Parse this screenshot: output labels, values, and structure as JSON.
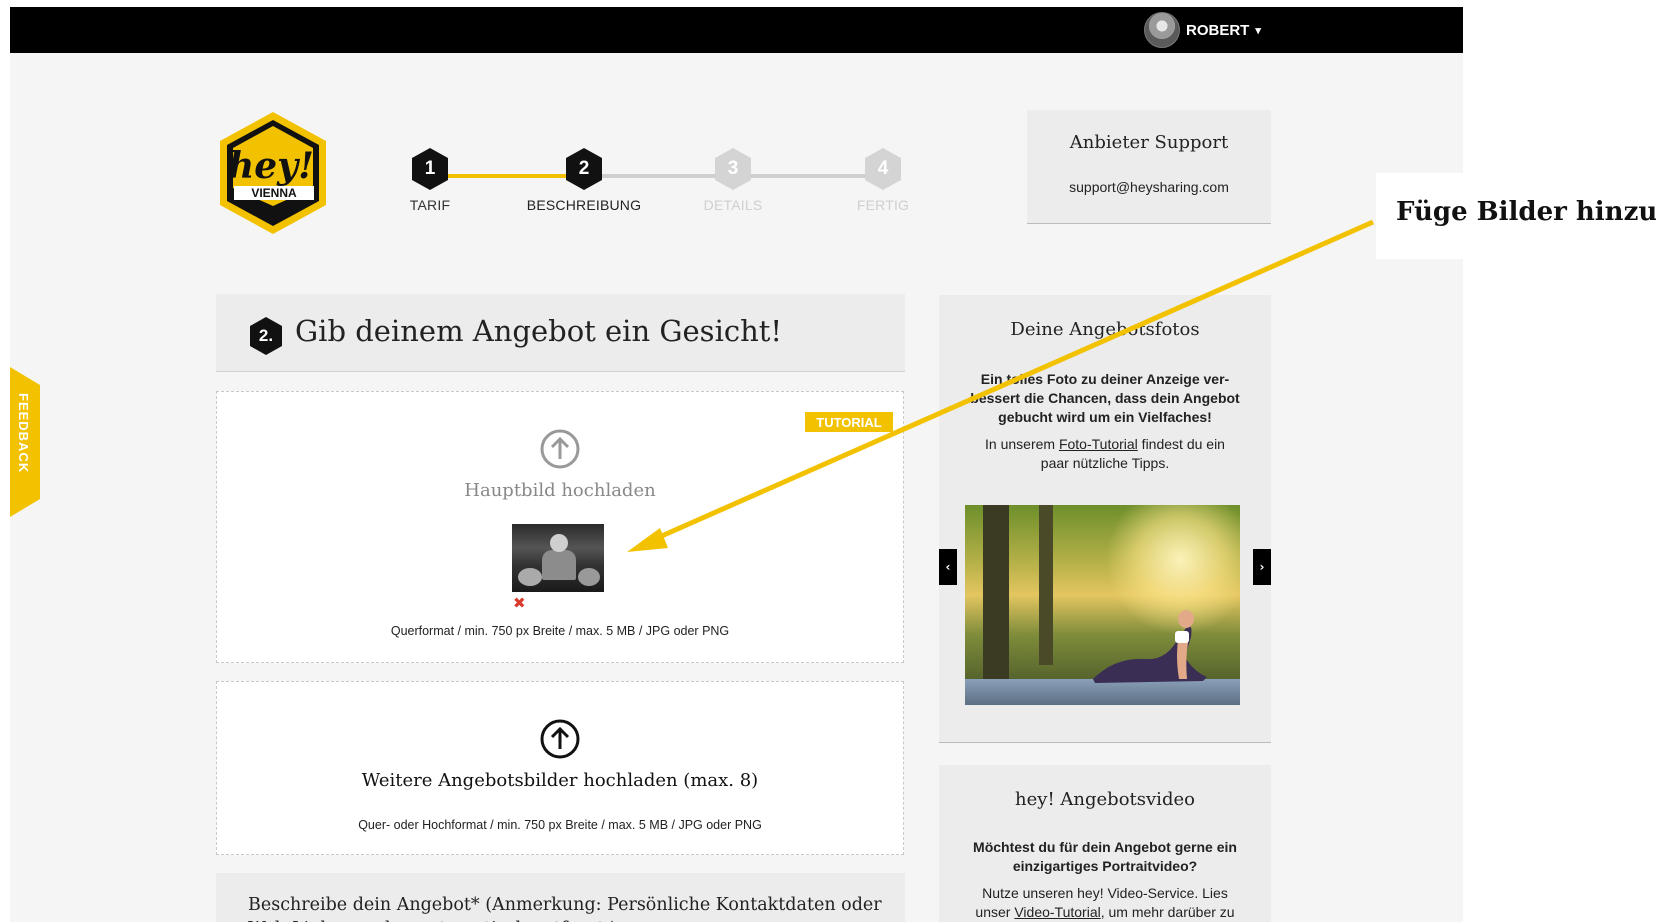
{
  "topbar": {
    "user_name": "ROBERT",
    "caret": "▾"
  },
  "logo": {
    "word": "hey!",
    "city": "VIENNA",
    "colors": {
      "yellow": "#f2c200",
      "black": "#111111"
    }
  },
  "steps": [
    {
      "number": "1",
      "label": "TARIF",
      "state": "done"
    },
    {
      "number": "2",
      "label": "BESCHREIBUNG",
      "state": "active"
    },
    {
      "number": "3",
      "label": "DETAILS",
      "state": "upcoming"
    },
    {
      "number": "4",
      "label": "FERTIG",
      "state": "upcoming"
    }
  ],
  "support": {
    "title": "Anbieter Support",
    "email": "support@heysharing.com"
  },
  "feedback": {
    "label": "FEEDBACK"
  },
  "section": {
    "number": "2.",
    "title": "Gib deinem Angebot ein Gesicht!"
  },
  "main_upload": {
    "tutorial_badge": "TUTORIAL",
    "label": "Hauptbild hochladen",
    "delete_icon": "✖",
    "hint": "Querformat / min. 750 px Breite / max. 5 MB / JPG oder PNG"
  },
  "more_upload": {
    "label": "Weitere Angebotsbilder hochladen (max. 8)",
    "hint": "Quer- oder Hochformat / min. 750 px Breite / max. 5 MB / JPG oder PNG"
  },
  "description": {
    "title": "Beschreibe dein Angebot* (Anmerkung: Persönliche Kontaktdaten oder Web-Links werden automatisch entfernt.)"
  },
  "photos_panel": {
    "title": "Deine Angebotsfotos",
    "bold_text": "Ein tolles Foto zu deiner Anzeige ver-bessert die Chancen, dass dein Angebot gebucht wird um ein Vielfaches!",
    "text_before": "In unserem ",
    "link": "Foto-Tutorial",
    "text_after": " findest du ein paar nützliche Tipps.",
    "prev": "‹",
    "next": "›"
  },
  "video_panel": {
    "title": "hey! Angebotsvideo",
    "bold_text": "Möchtest du für dein Angebot gerne ein einzigartiges Portraitvideo?",
    "text_before": "Nutze unseren hey! Video-Service. Lies unser ",
    "link": "Video-Tutorial",
    "text_after": ", um mehr darüber zu erfahren!"
  },
  "annotation": {
    "text": "Füge Bilder hinzu",
    "arrow_color": "#f2c200"
  }
}
